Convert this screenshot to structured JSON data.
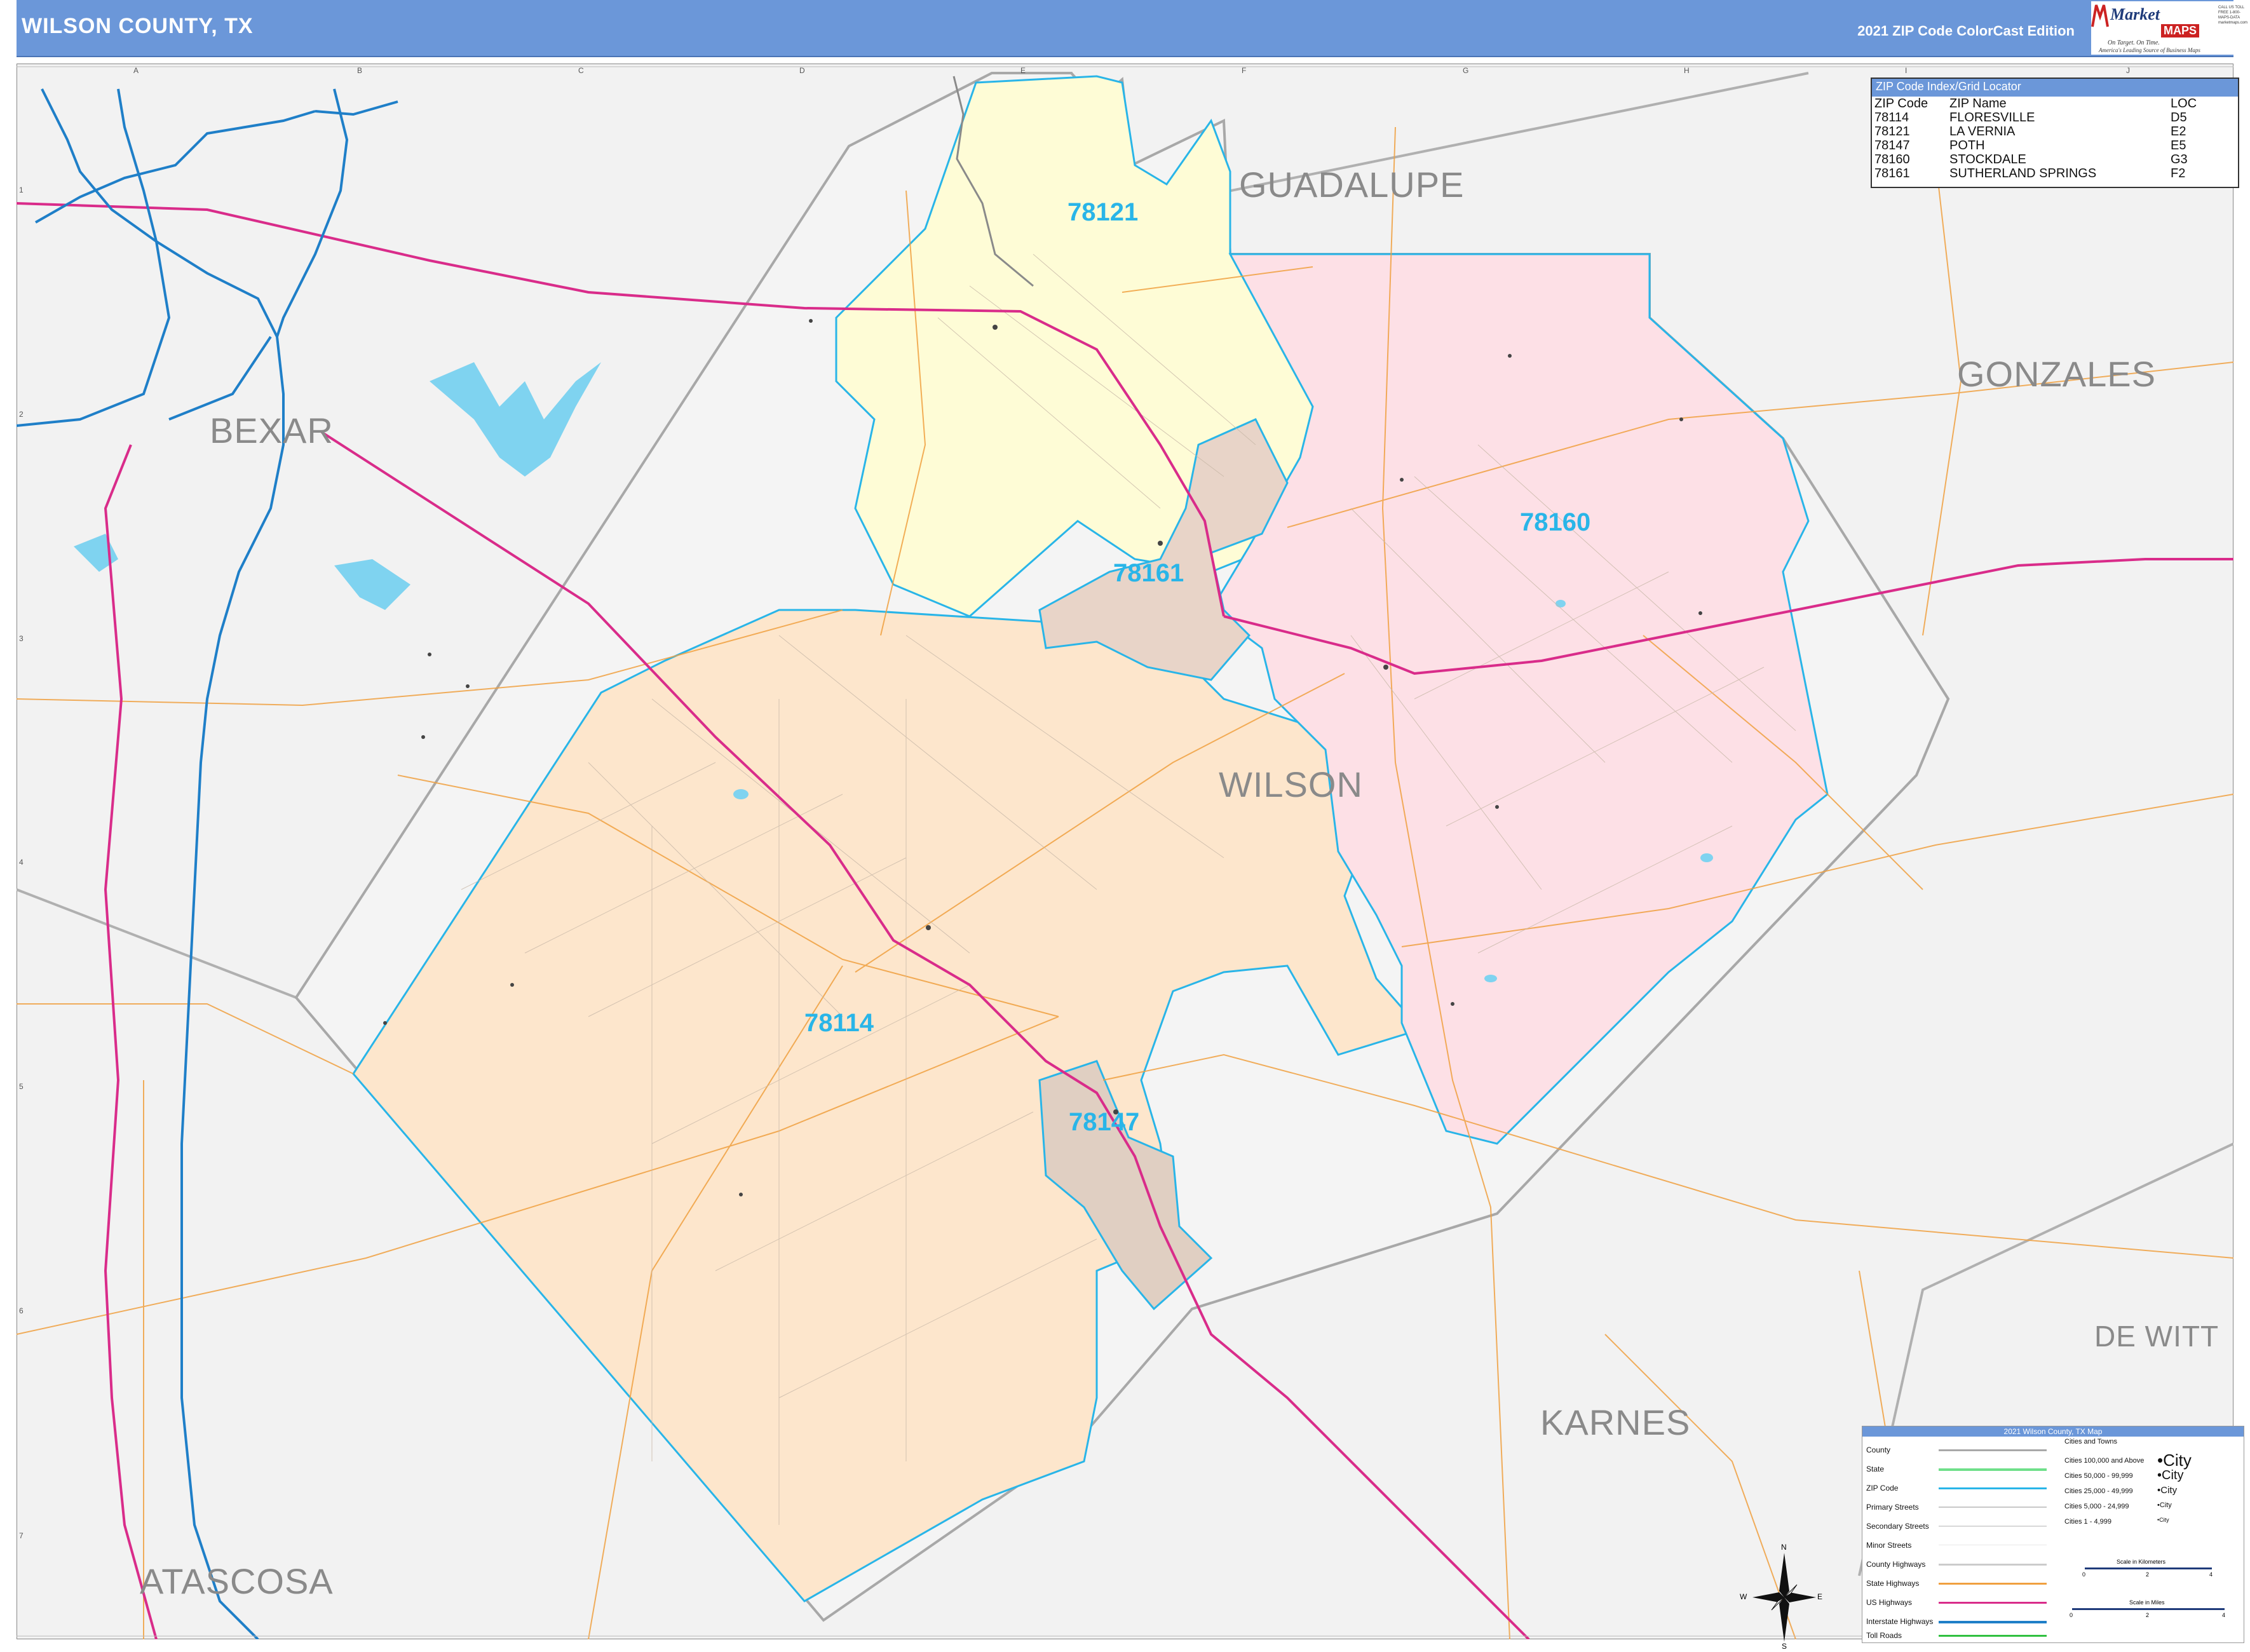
{
  "header": {
    "title": "WILSON COUNTY, TX",
    "edition": "2021 ZIP Code ColorCast Edition"
  },
  "logo": {
    "name": "Market",
    "maps": "MAPS",
    "tagline1": "On Target. On Time.",
    "tagline2": "America's Leading Source of Business Maps",
    "contact": "CALL US TOLL FREE 1-800-MAPS-DATA marketmaps.com"
  },
  "grid": {
    "columns": [
      "A",
      "B",
      "C",
      "D",
      "E",
      "F",
      "G",
      "H",
      "I",
      "J"
    ],
    "rows": [
      "1",
      "2",
      "3",
      "4",
      "5",
      "6",
      "7"
    ]
  },
  "zip_index": {
    "title": "ZIP Code Index/Grid Locator",
    "headers": [
      "ZIP Code",
      "ZIP Name",
      "LOC"
    ],
    "rows": [
      [
        "78114",
        "FLORESVILLE",
        "D5"
      ],
      [
        "78121",
        "LA VERNIA",
        "E2"
      ],
      [
        "78147",
        "POTH",
        "E5"
      ],
      [
        "78160",
        "STOCKDALE",
        "G3"
      ],
      [
        "78161",
        "SUTHERLAND SPRINGS",
        "F2"
      ]
    ]
  },
  "county_labels": {
    "guadalupe": "GUADALUPE",
    "gonzales": "GONZALES",
    "bexar": "BEXAR",
    "wilson": "WILSON",
    "de_witt": "DE WITT",
    "karnes": "KARNES",
    "atascosa": "ATASCOSA"
  },
  "zip_labels": {
    "z78121": "78121",
    "z78160": "78160",
    "z78161": "78161",
    "z78114": "78114",
    "z78147": "78147"
  },
  "colors": {
    "header_bg": "#6b97d9",
    "zip_78114": "#fde6cc",
    "zip_78121": "#fefcd6",
    "zip_78160": "#fde0e6",
    "zip_78161": "#e8d4c8",
    "zip_78147": "#e0cfc2",
    "zip_boundary": "#29b5e8",
    "county_line": "#a8a8a8",
    "interstate": "#1f7fc8",
    "us_highway": "#d92c8a",
    "state_highway": "#f0a040",
    "water": "#7fd3f0",
    "background": "#f2f2f2"
  },
  "legend": {
    "title": "2021 Wilson County, TX Map",
    "items": [
      "County",
      "State",
      "ZIP Code",
      "Primary Streets",
      "Secondary Streets",
      "Minor Streets",
      "County Highways",
      "State Highways",
      "US Highways",
      "Interstate Highways",
      "Toll Roads"
    ],
    "cities_heading": "Cities and Towns",
    "city_sizes": [
      "Cities 100,000 and Above",
      "Cities 50,000 - 99,999",
      "Cities 25,000 - 49,999",
      "Cities 5,000 - 24,999",
      "Cities 1 - 4,999"
    ],
    "city_samples": [
      "•City",
      "•City",
      "•City",
      "•City",
      "•City"
    ],
    "scale_km": "Scale in Kilometers",
    "scale_mi": "Scale in Miles",
    "scale_km_ticks": [
      "0",
      "2",
      "4"
    ],
    "scale_mi_ticks": [
      "0",
      "2",
      "4"
    ]
  },
  "compass": {
    "n": "N",
    "s": "S",
    "e": "E",
    "w": "W"
  }
}
